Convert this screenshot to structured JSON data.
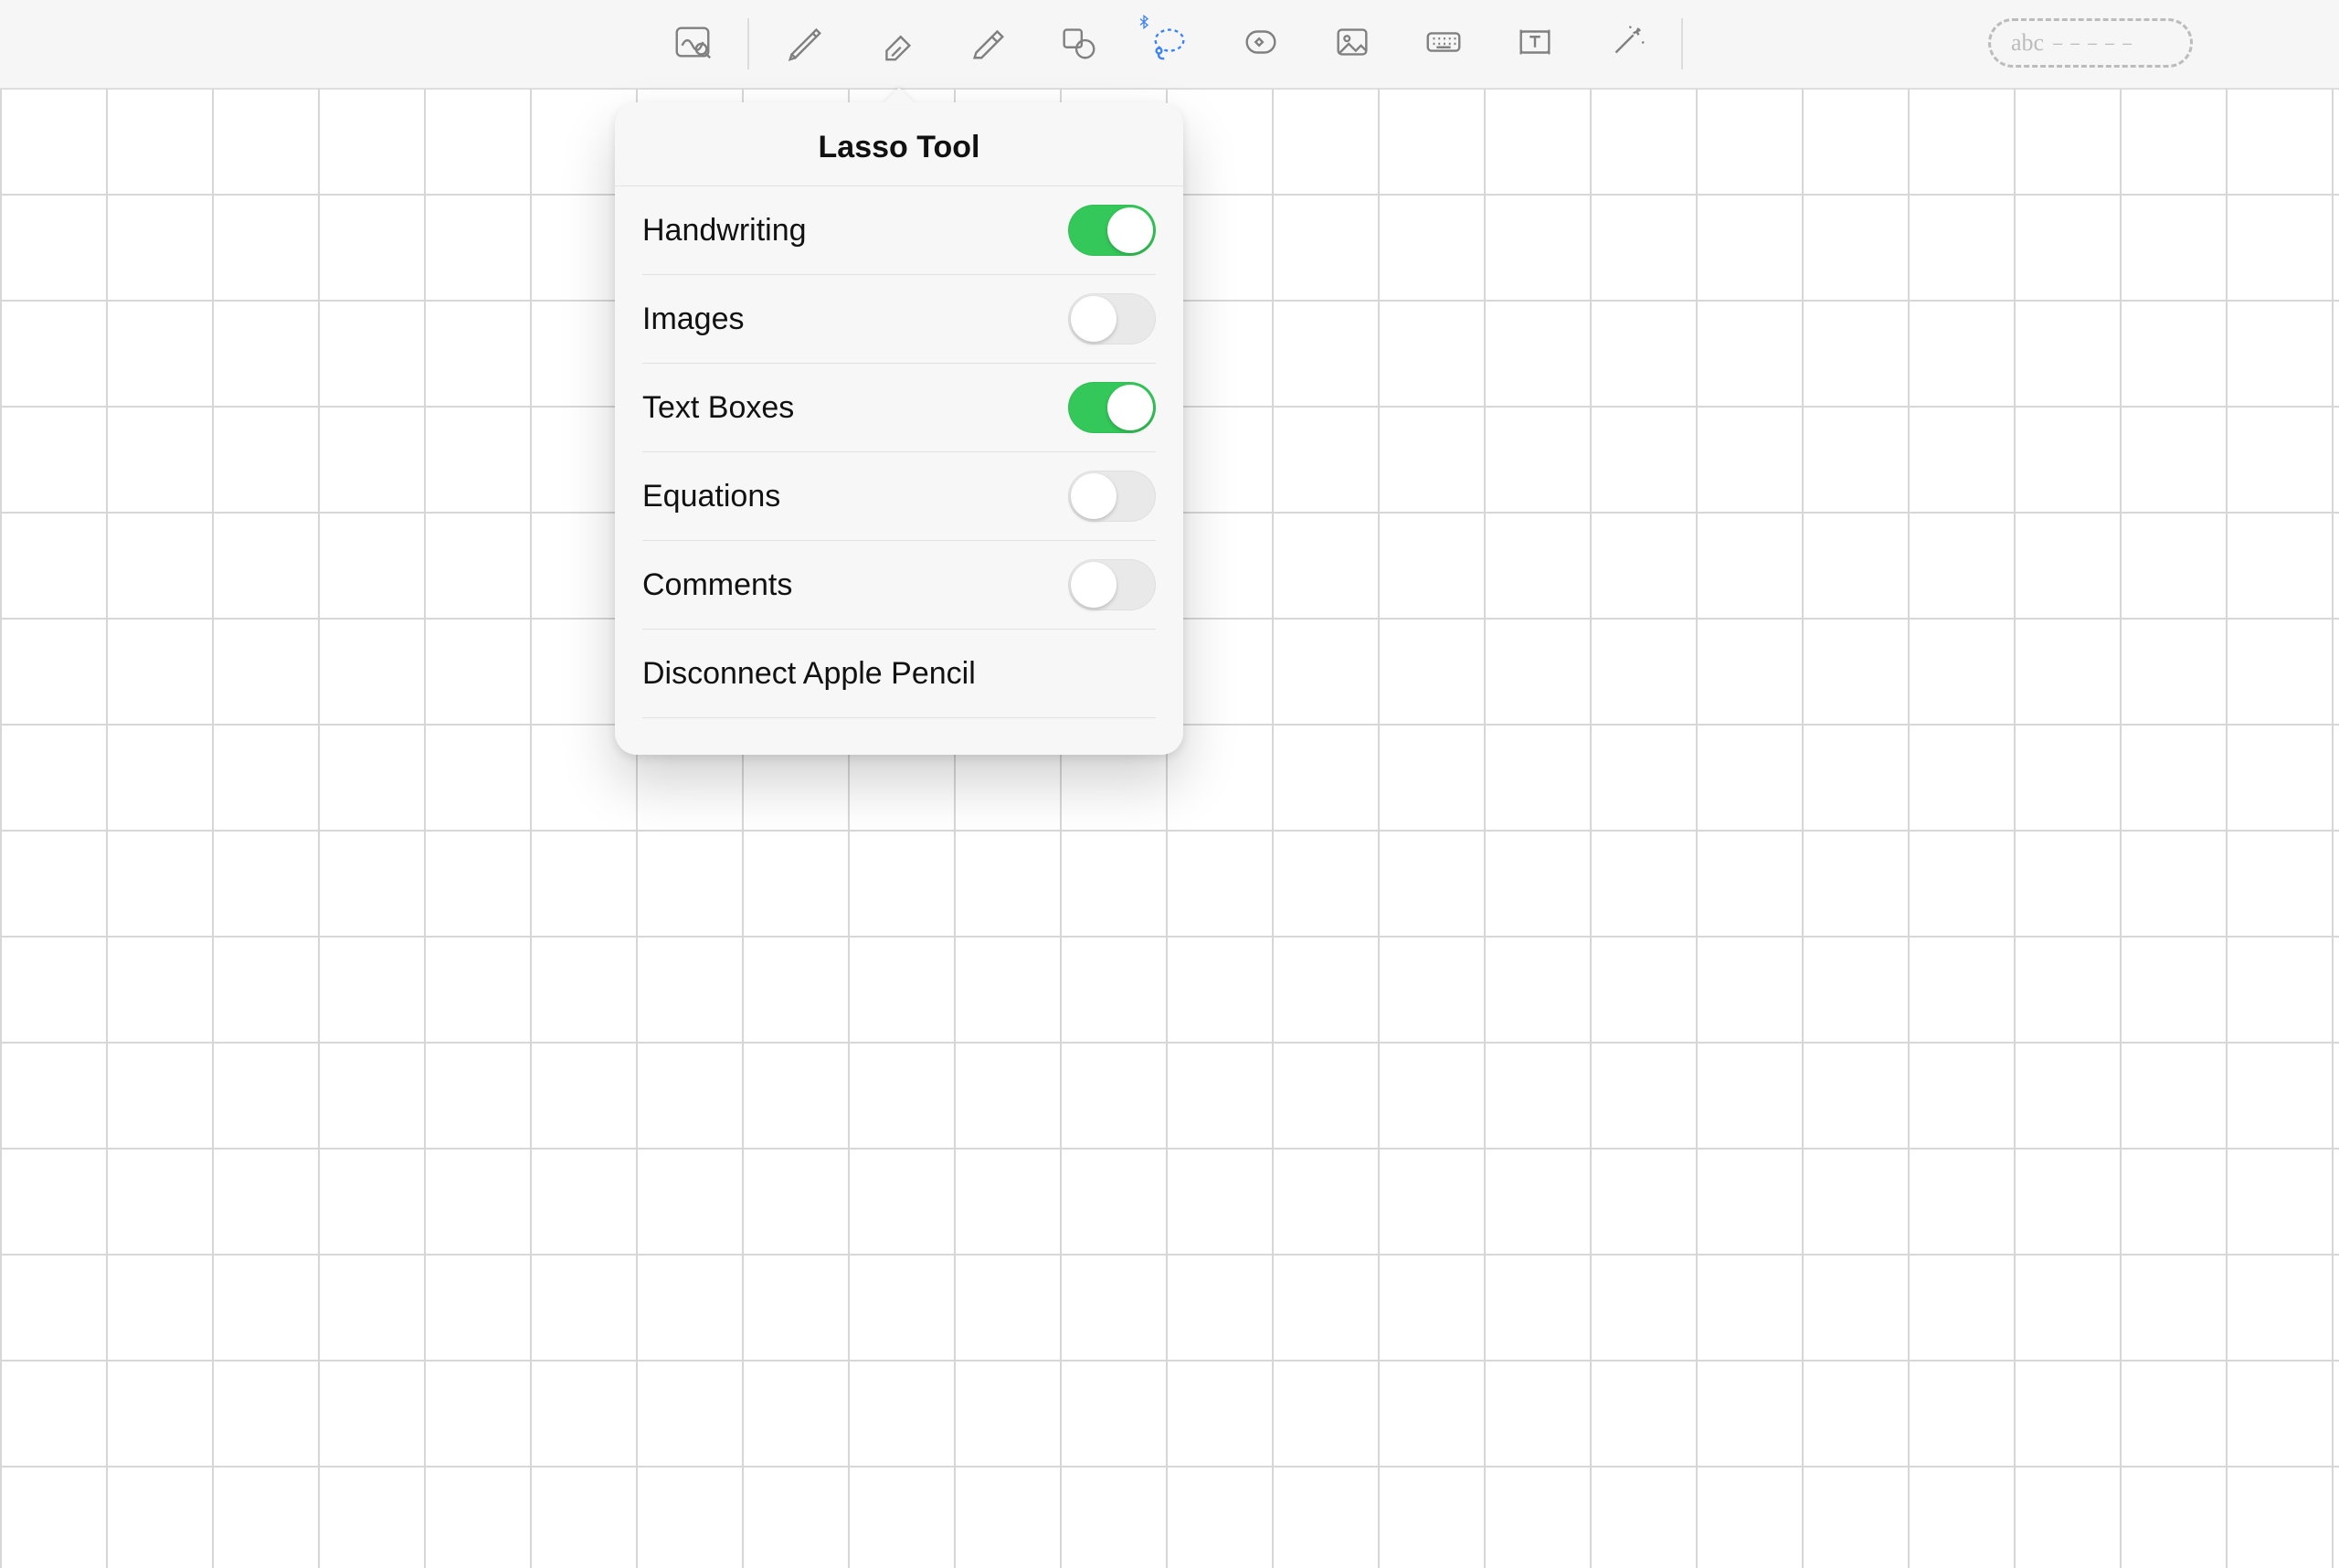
{
  "toolbar": {
    "tools": [
      {
        "name": "zoom-view",
        "icon": "zoom"
      },
      {
        "name": "pen",
        "icon": "pen"
      },
      {
        "name": "eraser",
        "icon": "eraser"
      },
      {
        "name": "highlighter",
        "icon": "highlighter"
      },
      {
        "name": "shapes",
        "icon": "shapes"
      },
      {
        "name": "lasso",
        "icon": "lasso",
        "active": true,
        "bt": true
      },
      {
        "name": "stickers",
        "icon": "sticker"
      },
      {
        "name": "image",
        "icon": "image"
      },
      {
        "name": "keyboard",
        "icon": "keyboard"
      },
      {
        "name": "textbox",
        "icon": "textbox"
      },
      {
        "name": "magic",
        "icon": "magic"
      }
    ],
    "handwrite_placeholder": "abc"
  },
  "popover": {
    "title": "Lasso Tool",
    "options": [
      {
        "label": "Handwriting",
        "on": true
      },
      {
        "label": "Images",
        "on": false
      },
      {
        "label": "Text Boxes",
        "on": true
      },
      {
        "label": "Equations",
        "on": false
      },
      {
        "label": "Comments",
        "on": false
      }
    ],
    "disconnect_label": "Disconnect Apple Pencil"
  },
  "colors": {
    "accent": "#3b82f6",
    "toggle_on": "#34c759"
  }
}
